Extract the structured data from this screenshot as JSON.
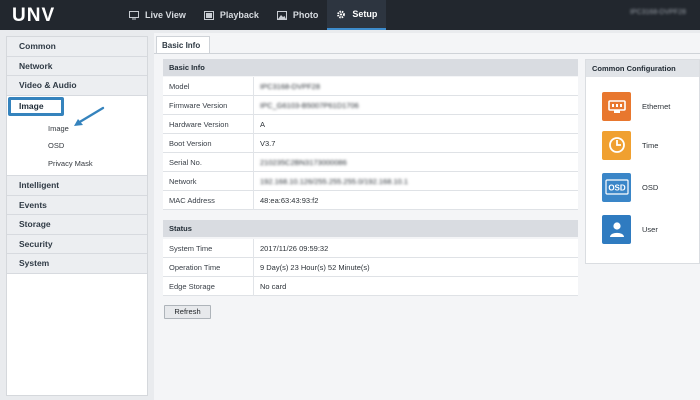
{
  "app": {
    "logo": "UNV",
    "device_id": "IPC3168-DVPF28"
  },
  "nav": [
    {
      "label": "Live View",
      "icon": "monitor-icon"
    },
    {
      "label": "Playback",
      "icon": "film-icon"
    },
    {
      "label": "Photo",
      "icon": "photo-icon"
    },
    {
      "label": "Setup",
      "icon": "gear-icon",
      "active": true
    }
  ],
  "sidebar": {
    "items": [
      "Common",
      "Network",
      "Video & Audio",
      "Image"
    ],
    "image_subitems": [
      "Image",
      "OSD",
      "Privacy Mask"
    ],
    "items_after": [
      "Intelligent",
      "Events",
      "Storage",
      "Security",
      "System"
    ]
  },
  "tab": {
    "label": "Basic Info"
  },
  "basic_info": {
    "title": "Basic Info",
    "rows": [
      {
        "key": "Model",
        "value": "IPC3168-DVPF28",
        "blurred": true
      },
      {
        "key": "Firmware Version",
        "value": "IPC_G6103-B5007P61D1706",
        "blurred": true
      },
      {
        "key": "Hardware Version",
        "value": "A",
        "blurred": false
      },
      {
        "key": "Boot Version",
        "value": "V3.7",
        "blurred": false
      },
      {
        "key": "Serial No.",
        "value": "210235C2BN3173000086",
        "blurred": true
      },
      {
        "key": "Network",
        "value": "192.168.10.126/255.255.255.0/192.168.10.1",
        "blurred": true
      },
      {
        "key": "MAC Address",
        "value": "48:ea:63:43:93:f2",
        "blurred": false
      }
    ]
  },
  "status": {
    "title": "Status",
    "rows": [
      {
        "key": "System Time",
        "value": "2017/11/26 09:59:32"
      },
      {
        "key": "Operation Time",
        "value": "9 Day(s) 23 Hour(s) 52 Minute(s)"
      },
      {
        "key": "Edge Storage",
        "value": "No card"
      }
    ]
  },
  "refresh_label": "Refresh",
  "common_config": {
    "title": "Common Configuration",
    "items": [
      {
        "label": "Ethernet",
        "icon": "ethernet-icon",
        "color": "#e8772e"
      },
      {
        "label": "Time",
        "icon": "clock-icon",
        "color": "#f0a030"
      },
      {
        "label": "OSD",
        "icon": "osd-icon",
        "color": "#3a86c8"
      },
      {
        "label": "User",
        "icon": "user-icon",
        "color": "#2f7bc0"
      }
    ]
  },
  "colors": {
    "accent": "#3583bd",
    "topbar": "#22272e"
  }
}
